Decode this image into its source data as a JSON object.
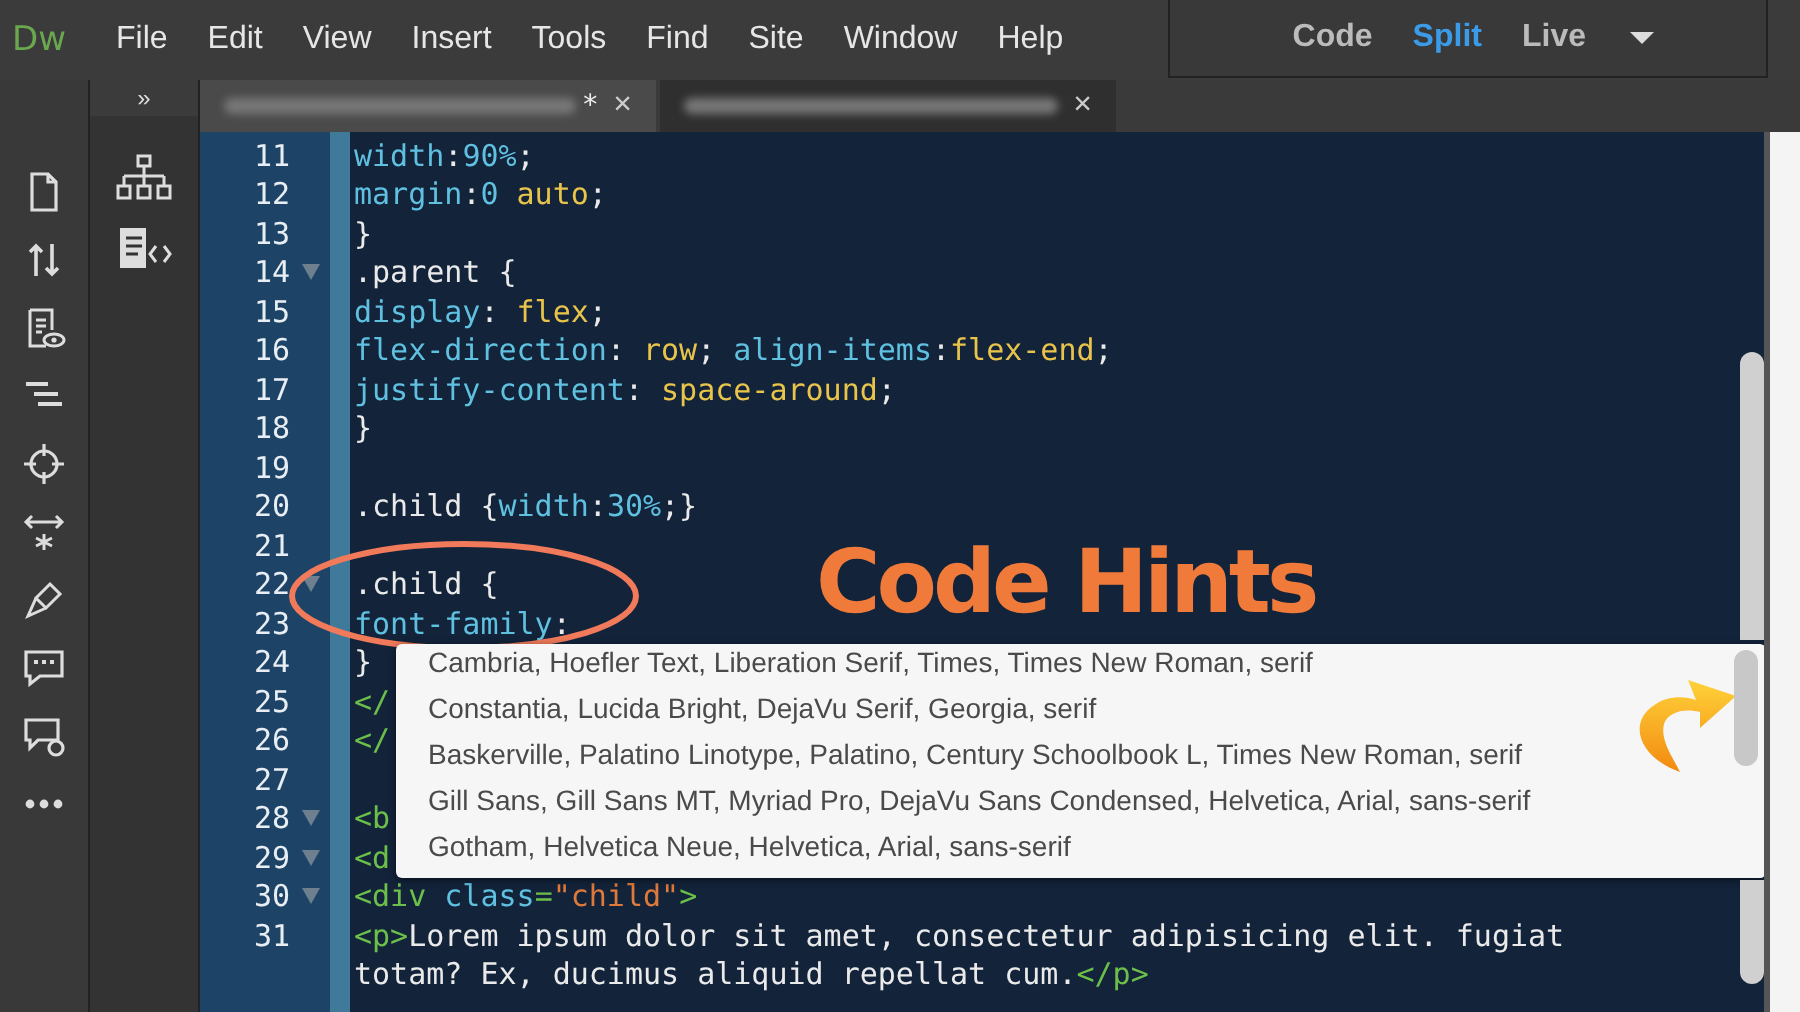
{
  "app": {
    "logo": "Dw",
    "menu": [
      "File",
      "Edit",
      "View",
      "Insert",
      "Tools",
      "Find",
      "Site",
      "Window",
      "Help"
    ]
  },
  "view_switcher": [
    {
      "label": "Code",
      "selected": false
    },
    {
      "label": "Split",
      "selected": true
    },
    {
      "label": "Live",
      "selected": false
    }
  ],
  "panel": {
    "collapse": "»"
  },
  "tabs": [
    {
      "close": "×",
      "modified": "*",
      "selected": true
    },
    {
      "close": "×",
      "selected": false
    }
  ],
  "code_lines": [
    {
      "number": "11",
      "fold": false,
      "segments": [
        {
          "kind": "prop",
          "text": "width"
        },
        {
          "kind": "plain",
          "text": ":"
        },
        {
          "kind": "prop",
          "text": "90%"
        },
        {
          "kind": "plain",
          "text": ";"
        }
      ]
    },
    {
      "number": "12",
      "fold": false,
      "segments": [
        {
          "kind": "prop",
          "text": "margin"
        },
        {
          "kind": "plain",
          "text": ":"
        },
        {
          "kind": "prop",
          "text": "0 "
        },
        {
          "kind": "val",
          "text": "auto"
        },
        {
          "kind": "plain",
          "text": ";"
        }
      ]
    },
    {
      "number": "13",
      "fold": false,
      "segments": [
        {
          "kind": "plain",
          "text": "}"
        }
      ]
    },
    {
      "number": "14",
      "fold": true,
      "segments": [
        {
          "kind": "plain",
          "text": ".parent {"
        }
      ]
    },
    {
      "number": "15",
      "fold": false,
      "segments": [
        {
          "kind": "prop",
          "text": "display"
        },
        {
          "kind": "plain",
          "text": ": "
        },
        {
          "kind": "val",
          "text": "flex"
        },
        {
          "kind": "plain",
          "text": ";"
        }
      ]
    },
    {
      "number": "16",
      "fold": false,
      "segments": [
        {
          "kind": "prop",
          "text": "flex-direction"
        },
        {
          "kind": "plain",
          "text": ": "
        },
        {
          "kind": "val",
          "text": "row"
        },
        {
          "kind": "plain",
          "text": "; "
        },
        {
          "kind": "prop",
          "text": "align-items"
        },
        {
          "kind": "plain",
          "text": ":"
        },
        {
          "kind": "val",
          "text": "flex-end"
        },
        {
          "kind": "plain",
          "text": ";"
        }
      ]
    },
    {
      "number": "17",
      "fold": false,
      "segments": [
        {
          "kind": "prop",
          "text": "justify-content"
        },
        {
          "kind": "plain",
          "text": ": "
        },
        {
          "kind": "val",
          "text": "space-around"
        },
        {
          "kind": "plain",
          "text": ";"
        }
      ]
    },
    {
      "number": "18",
      "fold": false,
      "segments": [
        {
          "kind": "plain",
          "text": "}"
        }
      ]
    },
    {
      "number": "19",
      "fold": false
    },
    {
      "number": "20",
      "fold": false,
      "segments": [
        {
          "kind": "plain",
          "text": ".child {"
        },
        {
          "kind": "prop",
          "text": "width"
        },
        {
          "kind": "plain",
          "text": ":"
        },
        {
          "kind": "prop",
          "text": "30%"
        },
        {
          "kind": "plain",
          "text": ";}"
        }
      ]
    },
    {
      "number": "21",
      "fold": false
    },
    {
      "number": "22",
      "fold": true,
      "segments": [
        {
          "kind": "plain",
          "text": ".child {"
        }
      ]
    },
    {
      "number": "23",
      "fold": false,
      "segments": [
        {
          "kind": "prop",
          "text": "font-family"
        },
        {
          "kind": "plain",
          "text": ":"
        }
      ]
    },
    {
      "number": "24",
      "fold": false,
      "segments": [
        {
          "kind": "plain",
          "text": "}"
        }
      ]
    },
    {
      "number": "25",
      "fold": false,
      "segments": [
        {
          "kind": "tag",
          "text": "</"
        }
      ]
    },
    {
      "number": "26",
      "fold": false,
      "segments": [
        {
          "kind": "tag",
          "text": "</"
        }
      ]
    },
    {
      "number": "27",
      "fold": false
    },
    {
      "number": "28",
      "fold": true,
      "segments": [
        {
          "kind": "tag",
          "text": "<b"
        }
      ]
    },
    {
      "number": "29",
      "fold": true,
      "segments": [
        {
          "kind": "tag",
          "text": "<d"
        }
      ]
    },
    {
      "number": "30",
      "fold": true,
      "segments": [
        {
          "kind": "tag",
          "text": "<div "
        },
        {
          "kind": "prop",
          "text": "class"
        },
        {
          "kind": "tag",
          "text": "="
        },
        {
          "kind": "str",
          "text": "\"child\""
        },
        {
          "kind": "tag",
          "text": ">"
        }
      ]
    },
    {
      "number": "31",
      "fold": false,
      "segments": [
        {
          "kind": "tag",
          "text": "<p>"
        },
        {
          "kind": "plain",
          "text": "Lorem ipsum dolor sit amet, consectetur adipisicing elit. fugiat"
        }
      ]
    },
    {
      "fold": false,
      "segments": [
        {
          "kind": "plain",
          "text": "totam? Ex, ducimus aliquid repellat cum."
        },
        {
          "kind": "tag",
          "text": "</p>"
        }
      ]
    }
  ],
  "annotation": {
    "title": "Code Hints"
  },
  "code_hints": [
    "Cambria, Hoefler Text, Liberation Serif, Times, Times New Roman, serif",
    "Constantia, Lucida Bright, DejaVu Serif, Georgia, serif",
    "Baskerville, Palatino Linotype, Palatino, Century Schoolbook L, Times New Roman, serif",
    "Gill Sans, Gill Sans MT, Myriad Pro, DejaVu Sans Condensed, Helvetica, Arial, sans-serif",
    "Gotham, Helvetica Neue, Helvetica, Arial, sans-serif"
  ]
}
